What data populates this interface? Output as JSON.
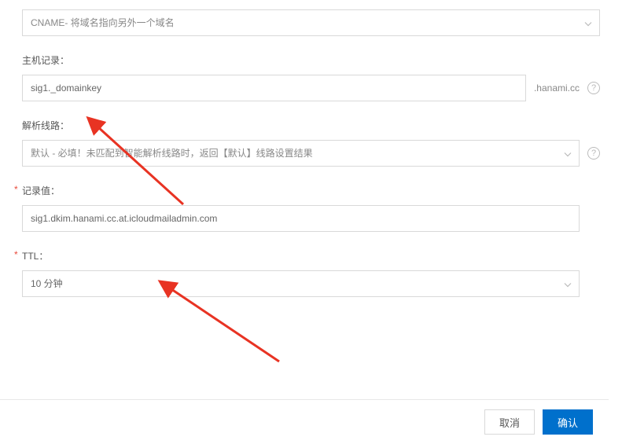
{
  "recordType": {
    "selected": "CNAME- 将域名指向另外一个域名"
  },
  "host": {
    "label": "主机记录：",
    "value": "sig1._domainkey",
    "suffix": ".hanami.cc"
  },
  "route": {
    "label": "解析线路：",
    "placeholder": "默认 - 必填！未匹配到智能解析线路时，返回【默认】线路设置结果"
  },
  "recordValue": {
    "label": "记录值：",
    "value": "sig1.dkim.hanami.cc.at.icloudmailadmin.com"
  },
  "ttl": {
    "label": "TTL：",
    "selected": "10 分钟"
  },
  "buttons": {
    "cancel": "取消",
    "ok": "确认"
  }
}
